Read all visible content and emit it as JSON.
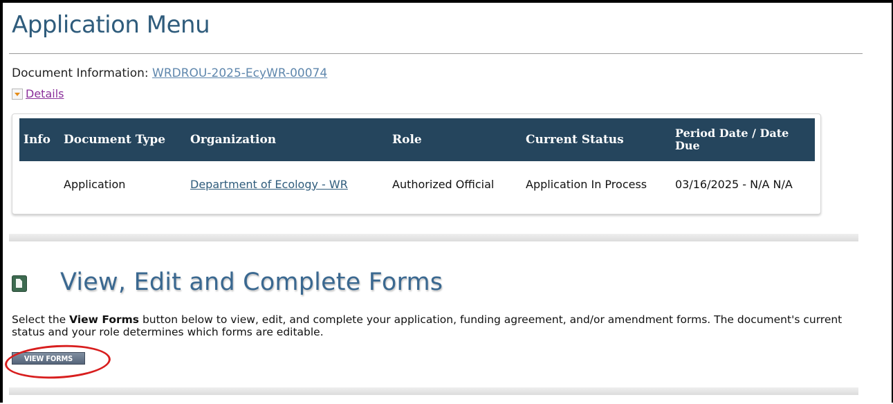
{
  "page": {
    "title": "Application Menu"
  },
  "document_info": {
    "label": "Document Information: ",
    "id_link": "WRDROU-2025-EcyWR-00074",
    "details_link": "Details"
  },
  "doc_table": {
    "headers": [
      "Info",
      "Document Type",
      "Organization",
      "Role",
      "Current Status",
      "Period Date / Date Due"
    ],
    "rows": [
      {
        "info": "",
        "document_type": "Application",
        "organization": "Department of Ecology - WR",
        "role": "Authorized Official",
        "current_status": "Application In Process",
        "period_date": "03/16/2025 - N/A N/A"
      }
    ]
  },
  "forms_section": {
    "title": "View, Edit and Complete Forms",
    "instruction_pre": "Select the ",
    "instruction_bold": "View Forms",
    "instruction_post": " button below to view, edit, and complete your application, funding agreement, and/or amendment forms. The document's current status and your role determines which forms are editable.",
    "button_label": "VIEW FORMS"
  },
  "colors": {
    "title": "#2f5c7c",
    "table_header": "#25455d",
    "highlight": "#d81e1e"
  }
}
